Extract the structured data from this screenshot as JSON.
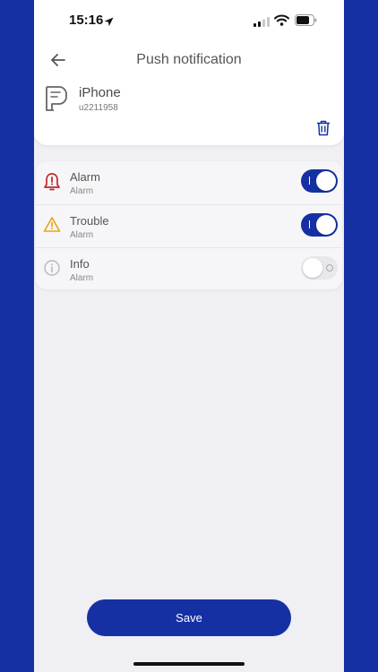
{
  "status_bar": {
    "time": "15:16",
    "icons": [
      "location-arrow-icon",
      "cellular-signal-icon",
      "wifi-icon",
      "battery-icon"
    ]
  },
  "header": {
    "title": "Push notification",
    "back_icon": "arrow-left-icon"
  },
  "device": {
    "name": "iPhone",
    "id": "u2211958",
    "icon": "chat-device-icon",
    "delete_icon": "trash-icon"
  },
  "notifications": [
    {
      "label": "Alarm",
      "sub": "Alarm",
      "icon": "bell-alert-icon",
      "icon_color": "#c1272d",
      "enabled": true
    },
    {
      "label": "Trouble",
      "sub": "Alarm",
      "icon": "warning-triangle-icon",
      "icon_color": "#e8a317",
      "enabled": true
    },
    {
      "label": "Info",
      "sub": "Alarm",
      "icon": "info-circle-icon",
      "icon_color": "#b8b8b8",
      "enabled": false
    }
  ],
  "actions": {
    "save_label": "Save"
  },
  "colors": {
    "accent": "#1530a3",
    "background": "#efeff4"
  }
}
